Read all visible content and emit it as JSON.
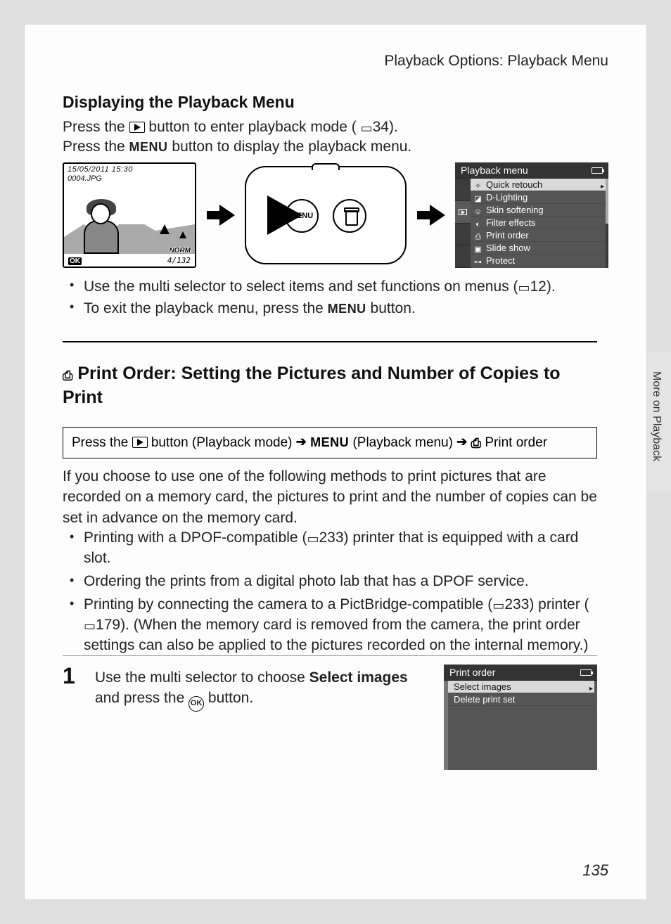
{
  "header": {
    "breadcrumb": "Playback Options: Playback Menu"
  },
  "section1": {
    "title": "Displaying the Playback Menu",
    "line1_a": "Press the ",
    "line1_b": " button to enter playback mode (",
    "line1_ref": "34",
    "line1_c": ").",
    "line2_a": "Press the ",
    "line2_menu": "MENU",
    "line2_b": " button to display the playback menu."
  },
  "lcd": {
    "timestamp": "15/05/2011 15:30",
    "filename": "0004.JPG",
    "quality": "NORM",
    "counter": "4/132",
    "ok_hint": "OK"
  },
  "camera": {
    "menu_label": "MENU"
  },
  "playback_menu": {
    "title": "Playback menu",
    "items": [
      {
        "icon": "✧",
        "label": "Quick retouch",
        "selected": true
      },
      {
        "icon": "◪",
        "label": "D-Lighting"
      },
      {
        "icon": "☺",
        "label": "Skin softening"
      },
      {
        "icon": "◐",
        "label": "Filter effects"
      },
      {
        "icon": "⎙",
        "label": "Print order"
      },
      {
        "icon": "▣",
        "label": "Slide show"
      },
      {
        "icon": "⊶",
        "label": "Protect"
      }
    ]
  },
  "bullets_after_fig": {
    "b1_a": "Use the multi selector to select items and set functions on menus (",
    "b1_ref": "12",
    "b1_b": ").",
    "b2_a": "To exit the playback menu, press the ",
    "b2_menu": "MENU",
    "b2_b": " button."
  },
  "section2": {
    "icon": "⎙",
    "title": " Print Order: Setting the Pictures and Number of Copies to Print"
  },
  "navpath": {
    "a": "Press the ",
    "b": " button (Playback mode) ",
    "menu": "MENU",
    "c": " (Playback menu) ",
    "d": " Print order"
  },
  "para2": "If you choose to use one of the following methods to print pictures that are recorded on a memory card, the pictures to print and the number of copies can be set in advance on the memory card.",
  "bullets2": {
    "b1_a": "Printing with a DPOF-compatible (",
    "b1_ref": "233",
    "b1_b": ") printer that is equipped with a card slot.",
    "b2": "Ordering the prints from a digital photo lab that has a DPOF service.",
    "b3_a": "Printing by connecting the camera to a PictBridge-compatible (",
    "b3_ref1": "233",
    "b3_b": ") printer (",
    "b3_ref2": "179",
    "b3_c": "). (When the memory card is removed from the camera, the print order settings can also be applied to the pictures recorded on the internal memory.)"
  },
  "step1": {
    "num": "1",
    "text_a": "Use the multi selector to choose ",
    "bold1": "Select images",
    "text_b": " and press the ",
    "ok": "OK",
    "text_c": " button."
  },
  "print_order_menu": {
    "title": "Print order",
    "items": [
      {
        "label": "Select images",
        "selected": true
      },
      {
        "label": "Delete print set"
      }
    ]
  },
  "side_tab": "More on Playback",
  "page_number": "135"
}
